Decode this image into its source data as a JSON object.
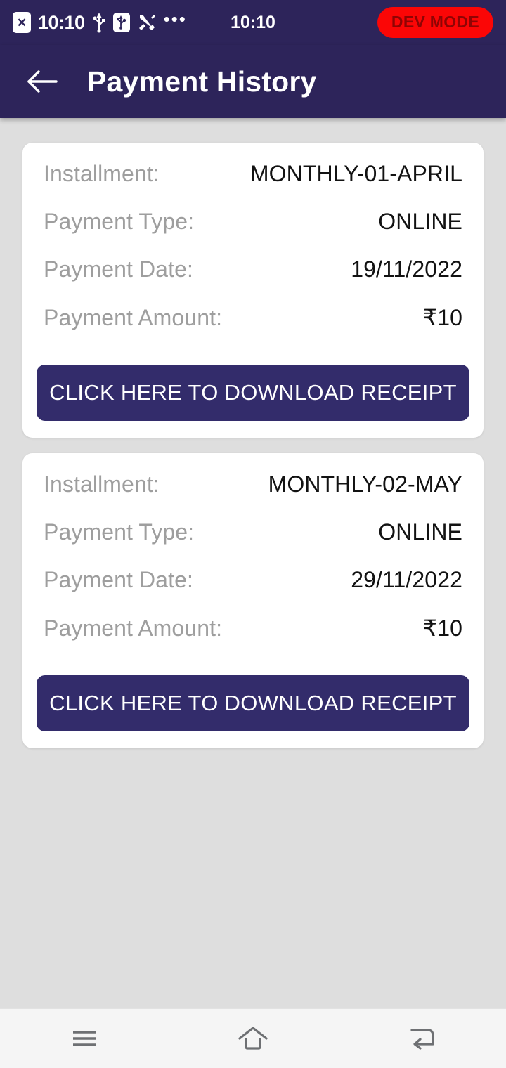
{
  "status_bar": {
    "sim_badge_icon": "sim-x-icon",
    "sim_badge_glyph": "✕",
    "time_left": "10:10",
    "usb_icon": "usb-icon",
    "usb_debug_icon": "usb-debug-icon",
    "tools_icon": "tools-icon",
    "overflow": "•••",
    "time_center": "10:10",
    "dev_mode_label": "DEV MODE",
    "dev_mode_color": "#fb0606"
  },
  "app_bar": {
    "back_icon": "back-arrow-icon",
    "title": "Payment History",
    "background_color": "#2d245a"
  },
  "labels": {
    "installment": "Installment:",
    "payment_type": "Payment Type:",
    "payment_date": "Payment Date:",
    "payment_amount": "Payment Amount:"
  },
  "download_button_label": "CLICK HERE TO DOWNLOAD RECEIPT",
  "accent_color": "#332c6b",
  "payments": [
    {
      "installment": "MONTHLY-01-APRIL",
      "payment_type": "ONLINE",
      "payment_date": "19/11/2022",
      "payment_amount": "₹10"
    },
    {
      "installment": "MONTHLY-02-MAY",
      "payment_type": "ONLINE",
      "payment_date": "29/11/2022",
      "payment_amount": "₹10"
    }
  ],
  "nav_bar": {
    "recents_icon": "recents-menu-icon",
    "home_icon": "home-icon",
    "back_icon": "back-nav-icon"
  }
}
